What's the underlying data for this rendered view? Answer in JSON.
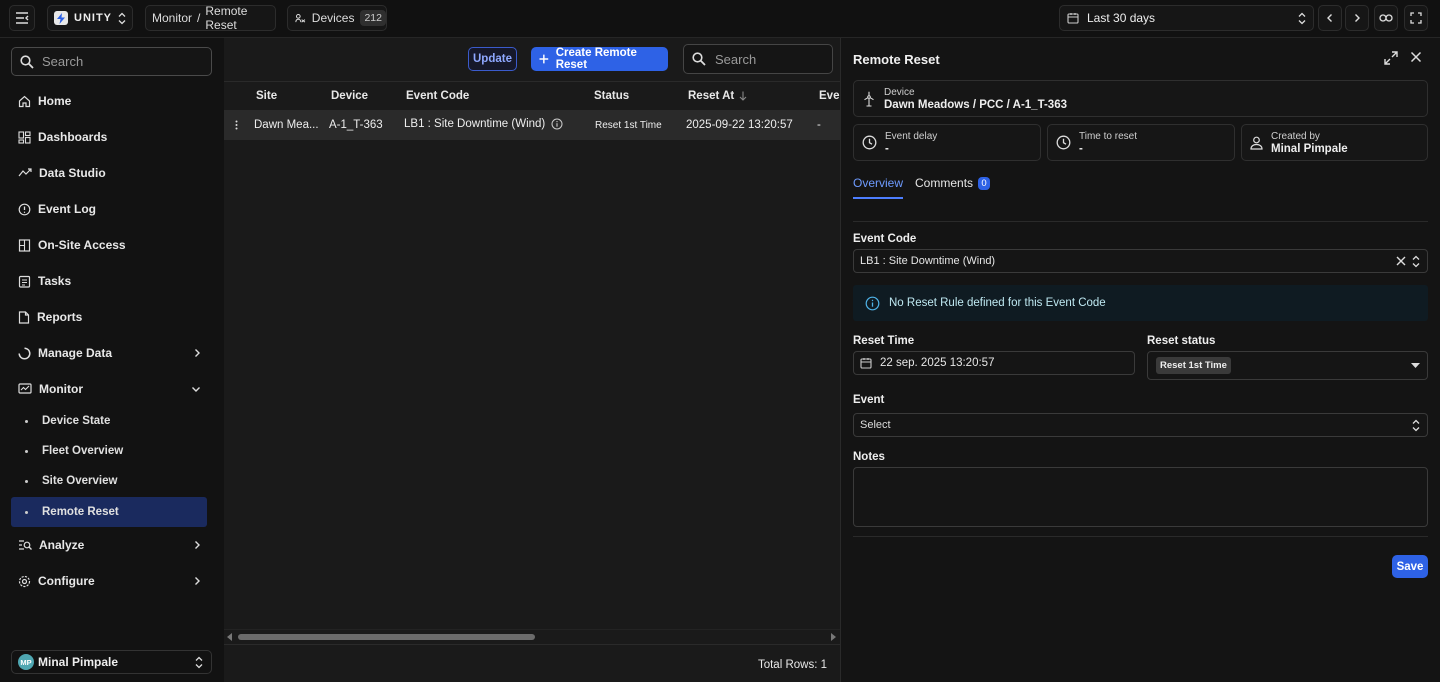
{
  "topbar": {
    "brand": "UNITY",
    "breadcrumb": [
      "Monitor",
      "/",
      "Remote Reset"
    ],
    "devices_label": "Devices",
    "devices_count": "212",
    "date_range": "Last 30 days"
  },
  "sidebar": {
    "search_placeholder": "Search",
    "items": [
      {
        "label": "Home",
        "icon": "home-icon"
      },
      {
        "label": "Dashboards",
        "icon": "dashboard-icon"
      },
      {
        "label": "Data Studio",
        "icon": "data-studio-icon"
      },
      {
        "label": "Event Log",
        "icon": "event-log-icon"
      },
      {
        "label": "On-Site Access",
        "icon": "onsite-access-icon"
      },
      {
        "label": "Tasks",
        "icon": "tasks-icon"
      },
      {
        "label": "Reports",
        "icon": "reports-icon"
      },
      {
        "label": "Manage Data",
        "icon": "manage-data-icon"
      },
      {
        "label": "Monitor",
        "icon": "monitor-icon"
      }
    ],
    "monitor_sub": [
      "Device State",
      "Fleet Overview",
      "Site Overview",
      "Remote Reset"
    ],
    "bottom_items": [
      {
        "label": "Analyze",
        "icon": "analyze-icon"
      },
      {
        "label": "Configure",
        "icon": "configure-icon"
      }
    ],
    "user": {
      "initials": "MP",
      "name": "Minal Pimpale"
    }
  },
  "table": {
    "update_label": "Update",
    "create_label": "Create Remote Reset",
    "search_placeholder": "Search",
    "columns": [
      "Site",
      "Device",
      "Event Code",
      "Status",
      "Reset At",
      "Ever"
    ],
    "rows": [
      {
        "site": "Dawn Mea...",
        "device": "A-1_T-363",
        "event_code": "LB1 : Site Downtime (Wind)",
        "status": "Reset 1st Time",
        "reset_at": "2025-09-22 13:20:57",
        "event": "-"
      }
    ],
    "total_rows": "Total Rows: 1"
  },
  "detail": {
    "title": "Remote Reset",
    "device_label": "Device",
    "device_value": "Dawn Meadows / PCC / A-1_T-363",
    "event_delay_label": "Event delay",
    "event_delay_value": "-",
    "time_to_reset_label": "Time to reset",
    "time_to_reset_value": "-",
    "created_by_label": "Created by",
    "created_by_value": "Minal Pimpale",
    "tab_overview": "Overview",
    "tab_comments": "Comments",
    "comments_count": "0",
    "event_code_label": "Event Code",
    "event_code_value": "LB1 : Site Downtime (Wind)",
    "info_text": "No Reset Rule defined for this Event Code",
    "reset_time_label": "Reset Time",
    "reset_time_value": "22 sep. 2025 13:20:57",
    "reset_status_label": "Reset status",
    "reset_status_value": "Reset 1st Time",
    "event_label": "Event",
    "event_placeholder": "Select",
    "notes_label": "Notes",
    "save_label": "Save"
  },
  "colors": {
    "accent": "#2e62e6",
    "active_nav": "#1a2a5e",
    "info_bg": "#0f1b22"
  }
}
